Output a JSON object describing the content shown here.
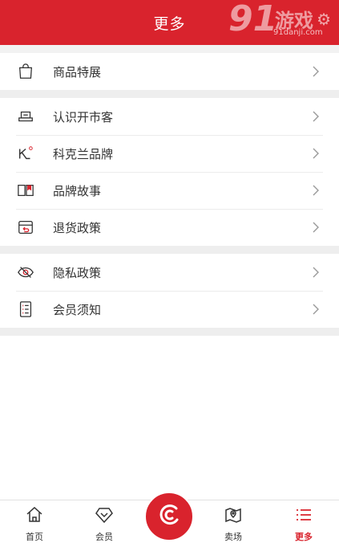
{
  "header": {
    "title": "更多",
    "watermark": {
      "mark": "91",
      "text": "游戏",
      "url": "91danji.com"
    }
  },
  "sections": [
    {
      "items": [
        {
          "icon": "shopping-bag-icon",
          "label": "商品特展"
        }
      ]
    },
    {
      "items": [
        {
          "icon": "store-icon",
          "label": "认识开市客"
        },
        {
          "icon": "kirkland-logo-icon",
          "label": "科克兰品牌"
        },
        {
          "icon": "book-icon",
          "label": "品牌故事"
        },
        {
          "icon": "return-box-icon",
          "label": "退货政策"
        }
      ]
    },
    {
      "items": [
        {
          "icon": "eye-slash-icon",
          "label": "隐私政策"
        },
        {
          "icon": "checklist-icon",
          "label": "会员须知"
        }
      ]
    }
  ],
  "nav": {
    "home": "首页",
    "member": "会员",
    "center_icon": "costco-c-icon",
    "stores": "卖场",
    "more": "更多",
    "active": "more"
  },
  "colors": {
    "brand": "#d9232d",
    "text": "#333333",
    "chevron": "#999999",
    "divider": "#eeeeee"
  }
}
